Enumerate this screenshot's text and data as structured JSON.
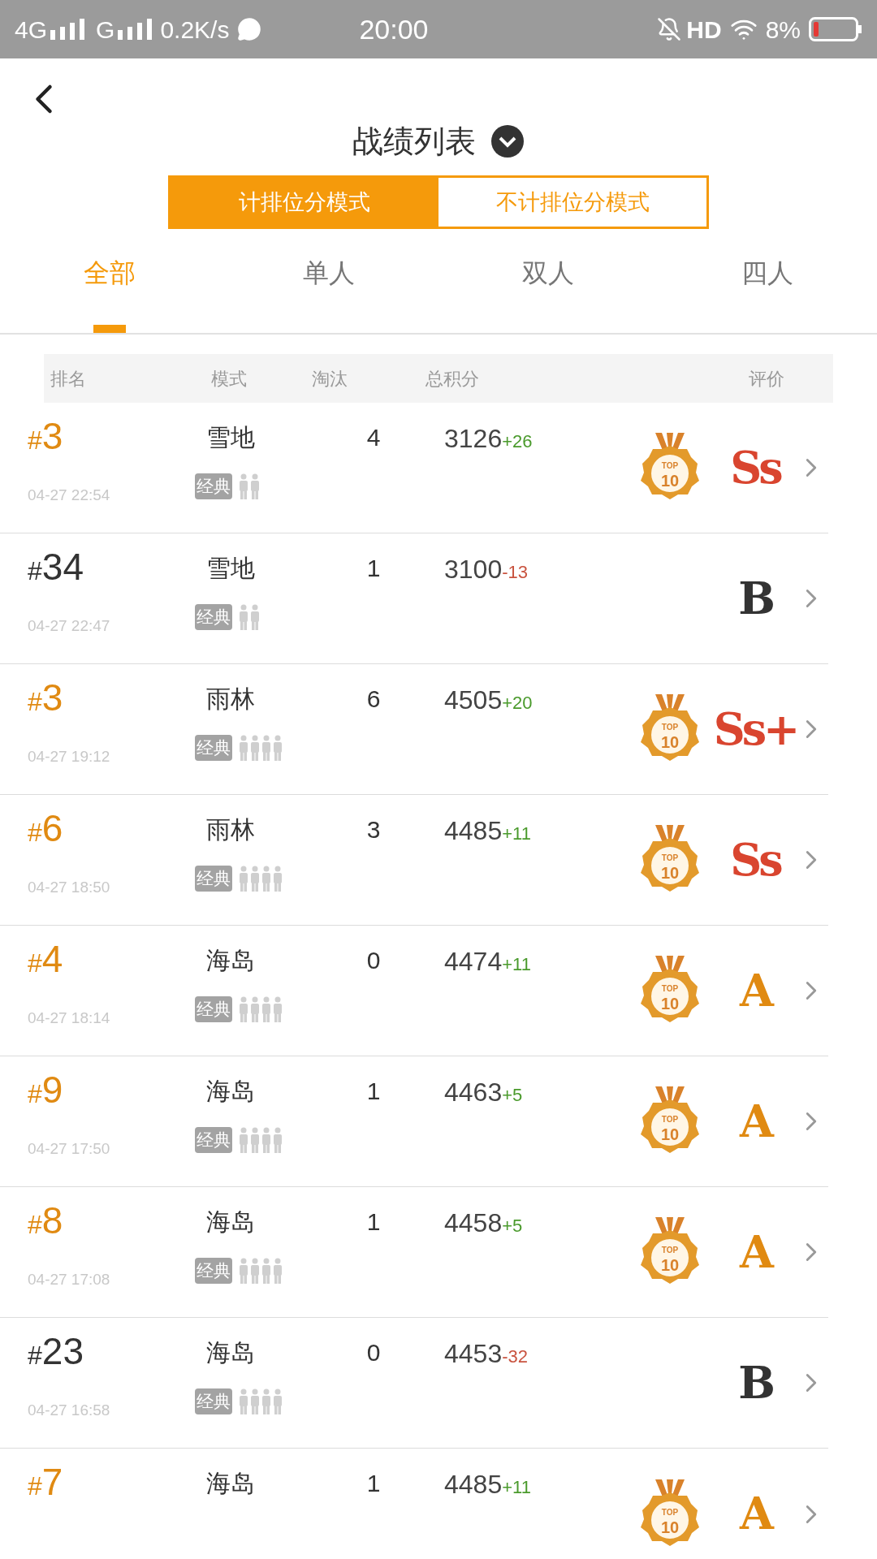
{
  "status_bar": {
    "network_1": "4G",
    "network_2": "G",
    "speed": "0.2K/s",
    "time": "20:00",
    "hd": "HD",
    "battery": "8%"
  },
  "header": {
    "title": "战绩列表"
  },
  "modes": [
    {
      "label": "计排位分模式",
      "selected": true
    },
    {
      "label": "不计排位分模式",
      "selected": false
    }
  ],
  "tabs": [
    {
      "label": "全部",
      "selected": true
    },
    {
      "label": "单人",
      "selected": false
    },
    {
      "label": "双人",
      "selected": false
    },
    {
      "label": "四人",
      "selected": false
    }
  ],
  "table": {
    "columns": [
      "排名",
      "模式",
      "淘汰",
      "总积分",
      "评价"
    ],
    "rows": [
      {
        "rank": "#3",
        "top10": true,
        "date": "04-27 22:54",
        "map": "雪地",
        "tag": "经典",
        "players": {
          "kind": "duo"
        },
        "kills": "4",
        "score": "3126",
        "delta": {
          "text": "+26",
          "color": "#4a9a2c"
        },
        "badge": [
          "TOP",
          "10"
        ],
        "grade": {
          "text": "Ss",
          "color": "#d9452f"
        }
      },
      {
        "rank": "#34",
        "top10": false,
        "date": "04-27 22:47",
        "map": "雪地",
        "tag": "经典",
        "players": {
          "kind": "duo"
        },
        "kills": "1",
        "score": "3100",
        "delta": {
          "text": "-13",
          "color": "#c9533f"
        },
        "grade": {
          "text": "B",
          "color": "#333333"
        }
      },
      {
        "rank": "#3",
        "top10": true,
        "date": "04-27 19:12",
        "map": "雨林",
        "tag": "经典",
        "players": {
          "kind": "squad"
        },
        "kills": "6",
        "score": "4505",
        "delta": {
          "text": "+20",
          "color": "#4a9a2c"
        },
        "badge": [
          "TOP",
          "10"
        ],
        "grade": {
          "text": "Ss+",
          "color": "#d9452f"
        }
      },
      {
        "rank": "#6",
        "top10": true,
        "date": "04-27 18:50",
        "map": "雨林",
        "tag": "经典",
        "players": {
          "kind": "squad"
        },
        "kills": "3",
        "score": "4485",
        "delta": {
          "text": "+11",
          "color": "#4a9a2c"
        },
        "badge": [
          "TOP",
          "10"
        ],
        "grade": {
          "text": "Ss",
          "color": "#d9452f"
        }
      },
      {
        "rank": "#4",
        "top10": true,
        "date": "04-27 18:14",
        "map": "海岛",
        "tag": "经典",
        "players": {
          "kind": "squad"
        },
        "kills": "0",
        "score": "4474",
        "delta": {
          "text": "+11",
          "color": "#4a9a2c"
        },
        "badge": [
          "TOP",
          "10"
        ],
        "grade": {
          "text": "A",
          "color": "#e08a12"
        }
      },
      {
        "rank": "#9",
        "top10": true,
        "date": "04-27 17:50",
        "map": "海岛",
        "tag": "经典",
        "players": {
          "kind": "squad"
        },
        "kills": "1",
        "score": "4463",
        "delta": {
          "text": "+5",
          "color": "#4a9a2c"
        },
        "badge": [
          "TOP",
          "10"
        ],
        "grade": {
          "text": "A",
          "color": "#e08a12"
        }
      },
      {
        "rank": "#8",
        "top10": true,
        "date": "04-27 17:08",
        "map": "海岛",
        "tag": "经典",
        "players": {
          "kind": "squad"
        },
        "kills": "1",
        "score": "4458",
        "delta": {
          "text": "+5",
          "color": "#4a9a2c"
        },
        "badge": [
          "TOP",
          "10"
        ],
        "grade": {
          "text": "A",
          "color": "#e08a12"
        }
      },
      {
        "rank": "#23",
        "top10": false,
        "date": "04-27 16:58",
        "map": "海岛",
        "tag": "经典",
        "players": {
          "kind": "squad"
        },
        "kills": "0",
        "score": "4453",
        "delta": {
          "text": "-32",
          "color": "#c9533f"
        },
        "grade": {
          "text": "B",
          "color": "#333333"
        }
      },
      {
        "rank": "#7",
        "top10": true,
        "map": "海岛",
        "kills": "1",
        "score": "4485",
        "delta": {
          "text": "+11",
          "color": "#4a9a2c"
        },
        "badge": [
          "TOP",
          "10"
        ],
        "grade": {
          "text": "A",
          "color": "#e08a12"
        }
      }
    ]
  }
}
